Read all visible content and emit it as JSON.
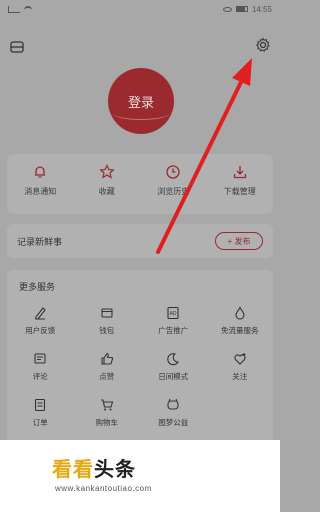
{
  "status": {
    "time": "14:55",
    "battery": "80%"
  },
  "header": {
    "scan_icon": "scan-icon",
    "settings_icon": "gear-icon"
  },
  "login": {
    "label": "登录"
  },
  "quick_actions": [
    {
      "label": "消息通知",
      "icon": "bell-icon"
    },
    {
      "label": "收藏",
      "icon": "star-icon"
    },
    {
      "label": "浏览历史",
      "icon": "clock-icon"
    },
    {
      "label": "下载管理",
      "icon": "download-icon"
    }
  ],
  "record": {
    "label": "记录新鲜事",
    "publish_label": "+ 发布"
  },
  "services": {
    "title": "更多服务",
    "items": [
      {
        "label": "用户反馈",
        "icon": "feedback-icon"
      },
      {
        "label": "钱包",
        "icon": "wallet-icon"
      },
      {
        "label": "广告推广",
        "icon": "ad-icon"
      },
      {
        "label": "免流量服务",
        "icon": "drop-icon"
      },
      {
        "label": "评论",
        "icon": "comment-icon"
      },
      {
        "label": "点赞",
        "icon": "thumbs-up-icon"
      },
      {
        "label": "日间模式",
        "icon": "moon-icon"
      },
      {
        "label": "关注",
        "icon": "heart-plus-icon"
      },
      {
        "label": "订单",
        "icon": "order-icon"
      },
      {
        "label": "购物车",
        "icon": "cart-icon"
      },
      {
        "label": "图梦公益",
        "icon": "charity-icon"
      }
    ]
  },
  "watermark": {
    "brand_a": "看看",
    "brand_b": "头条",
    "url": "www.kankantoutiao.com"
  },
  "colors": {
    "accent": "#9b2a2f",
    "arrow": "#e02020",
    "overlay": "#a8a8a8"
  }
}
